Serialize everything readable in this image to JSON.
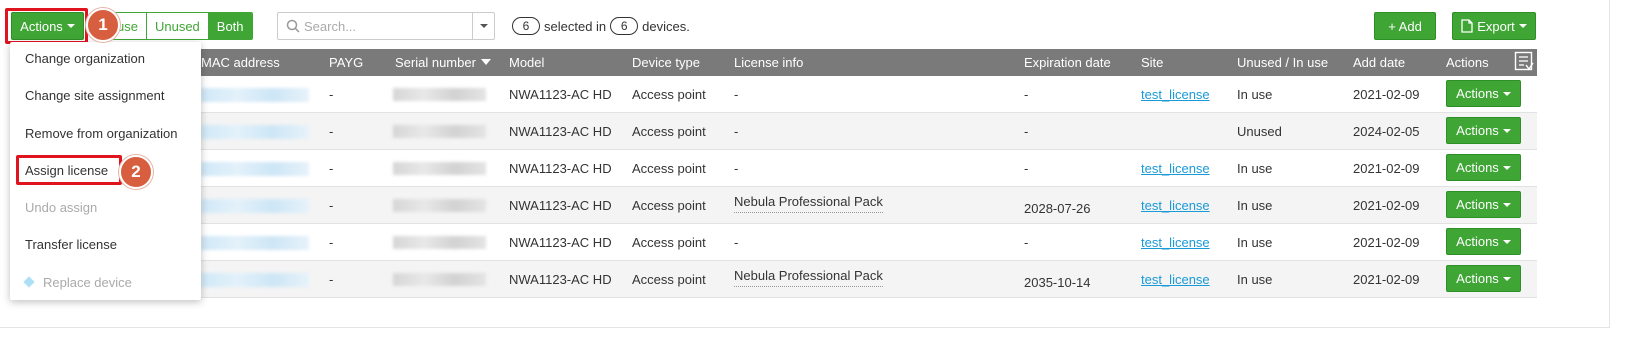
{
  "toolbar": {
    "actions_label": "Actions",
    "filter_segments": [
      "use",
      "Unused",
      "Both"
    ],
    "search_placeholder": "Search...",
    "selected_count": "6",
    "selected_text": "selected in",
    "device_count": "6",
    "devices_text": "devices.",
    "add_label": "+ Add",
    "export_label": "Export"
  },
  "table": {
    "headers": {
      "mac": "MAC address",
      "payg": "PAYG",
      "serial": "Serial number",
      "model": "Model",
      "device_type": "Device type",
      "license_info": "License info",
      "expiration": "Expiration date",
      "site": "Site",
      "usage": "Unused / In use",
      "add_date": "Add date",
      "actions": "Actions"
    },
    "rows": [
      {
        "payg": "-",
        "model": "NWA1123-AC HD",
        "device_type": "Access point",
        "license": "-",
        "expiration": "-",
        "site": "test_license",
        "usage": "In use",
        "add_date": "2021-02-09",
        "action": "Actions"
      },
      {
        "payg": "-",
        "model": "NWA1123-AC HD",
        "device_type": "Access point",
        "license": "-",
        "expiration": "-",
        "site": "",
        "usage": "Unused",
        "add_date": "2024-02-05",
        "action": "Actions"
      },
      {
        "payg": "-",
        "model": "NWA1123-AC HD",
        "device_type": "Access point",
        "license": "-",
        "expiration": "-",
        "site": "test_license",
        "usage": "In use",
        "add_date": "2021-02-09",
        "action": "Actions"
      },
      {
        "payg": "-",
        "model": "NWA1123-AC HD",
        "device_type": "Access point",
        "license": "Nebula Professional Pack",
        "expiration": "2028-07-26",
        "site": "test_license",
        "usage": "In use",
        "add_date": "2021-02-09",
        "action": "Actions"
      },
      {
        "payg": "-",
        "model": "NWA1123-AC HD",
        "device_type": "Access point",
        "license": "-",
        "expiration": "-",
        "site": "test_license",
        "usage": "In use",
        "add_date": "2021-02-09",
        "action": "Actions"
      },
      {
        "payg": "-",
        "model": "NWA1123-AC HD",
        "device_type": "Access point",
        "license": "Nebula Professional Pack",
        "expiration": "2035-10-14",
        "site": "test_license",
        "usage": "In use",
        "add_date": "2021-02-09",
        "action": "Actions"
      }
    ]
  },
  "menu": {
    "items": [
      "Change organization",
      "Change site assignment",
      "Remove from organization",
      "Assign license",
      "Undo assign",
      "Transfer license",
      "Replace device"
    ]
  },
  "badges": [
    "1",
    "2"
  ],
  "colors": {
    "accent_green": "#3fa535",
    "header_gray": "#7a7a7a",
    "highlight_red": "#e0141e",
    "badge_orange": "#d75f40",
    "link_blue": "#1a9ad6"
  }
}
